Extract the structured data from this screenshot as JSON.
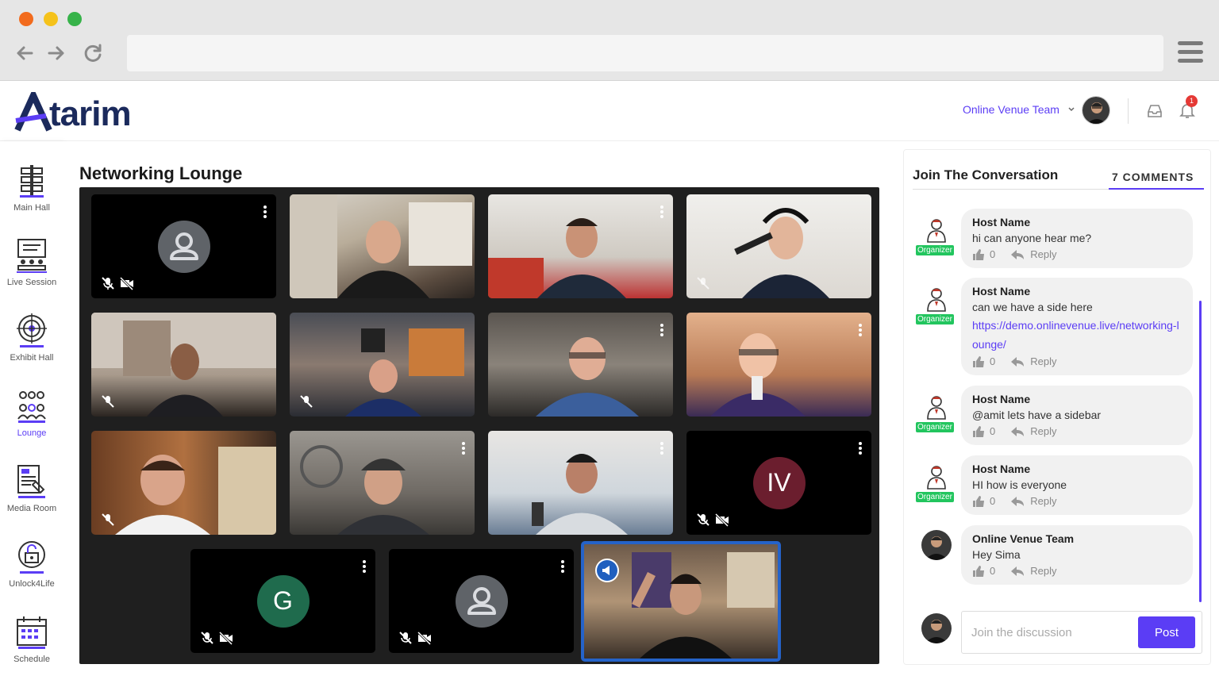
{
  "brand": {
    "logo_text": "tarim",
    "accent": "#5b3df5"
  },
  "header": {
    "team_label": "Online Venue Team",
    "notification_count": "1"
  },
  "sidebar": {
    "items": [
      {
        "label": "Main Hall",
        "icon": "signpost-icon"
      },
      {
        "label": "Live Session",
        "icon": "presentation-icon"
      },
      {
        "label": "Exhibit Hall",
        "icon": "target-icon"
      },
      {
        "label": "Lounge",
        "icon": "people-group-icon",
        "active": true
      },
      {
        "label": "Media Room",
        "icon": "newspaper-icon"
      },
      {
        "label": "Unlock4Life",
        "icon": "unlock-icon"
      },
      {
        "label": "Schedule",
        "icon": "calendar-icon"
      }
    ]
  },
  "lounge": {
    "title": "Networking Lounge",
    "tiles": [
      {
        "type": "placeholder",
        "muted": true,
        "camera_off": true
      },
      {
        "type": "video",
        "muted": false
      },
      {
        "type": "video",
        "muted": false
      },
      {
        "type": "video",
        "muted": true
      },
      {
        "type": "video",
        "muted": true
      },
      {
        "type": "video",
        "muted": true
      },
      {
        "type": "video",
        "muted": false
      },
      {
        "type": "video",
        "muted": false
      },
      {
        "type": "video",
        "muted": true
      },
      {
        "type": "video",
        "muted": false
      },
      {
        "type": "video",
        "muted": false
      },
      {
        "type": "initials",
        "initials": "IV",
        "color": "#6b1e2e",
        "muted": true,
        "camera_off": true
      },
      {
        "type": "initials",
        "initials": "G",
        "color": "#1f6b4d",
        "muted": true,
        "camera_off": true
      },
      {
        "type": "placeholder",
        "muted": true,
        "camera_off": true
      },
      {
        "type": "video",
        "speaking": true
      }
    ]
  },
  "conversation": {
    "title": "Join The Conversation",
    "count_label": "7 COMMENTS",
    "organizer_tag": "Organizer",
    "reply_label": "Reply",
    "comments": [
      {
        "name": "Host Name",
        "text": "hi can anyone hear me?",
        "likes": "0"
      },
      {
        "name": "Host Name",
        "text": "can we have a side here",
        "link": "https://demo.onlinevenue.live/networking-lounge/",
        "likes": "0"
      },
      {
        "name": "Host Name",
        "text": "@amit lets have a sidebar",
        "likes": "0"
      },
      {
        "name": "Host Name",
        "text": "HI how is everyone",
        "likes": "0"
      },
      {
        "name": "Online Venue Team",
        "text": "Hey Sima",
        "likes": "0"
      }
    ],
    "composer": {
      "placeholder": "Join the discussion",
      "post_label": "Post"
    }
  }
}
